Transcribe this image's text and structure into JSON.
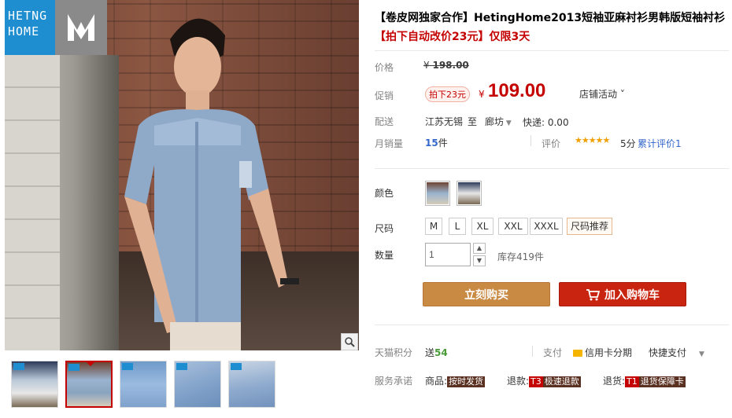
{
  "brand": {
    "logo_text_line1": "HETNG",
    "logo_text_line2": "HOME"
  },
  "product": {
    "title": "【卷皮网独家合作】HetingHome2013短袖亚麻衬衫男韩版短袖衬衫",
    "promo": "【拍下自动改价23元】仅限3天"
  },
  "price": {
    "label": "价格",
    "currency": "¥",
    "original": "198.00"
  },
  "promotion": {
    "label": "促销",
    "badge": "拍下23元",
    "currency": "¥",
    "value": "109.00",
    "activity": "店铺活动"
  },
  "shipping": {
    "label": "配送",
    "from": "江苏无锡",
    "to_word": "至",
    "destination": "廊坊",
    "fee": "快递: 0.00"
  },
  "sales": {
    "label": "月销量",
    "count": "15",
    "unit": "件",
    "review_label": "评价",
    "stars": "★★★★★",
    "score": "5分",
    "review_link": "累计评价1"
  },
  "color": {
    "label": "颜色"
  },
  "size": {
    "label": "尺码",
    "options": [
      "M",
      "L",
      "XL",
      "XXL",
      "XXXL"
    ],
    "recommend": "尺码推荐"
  },
  "quantity": {
    "label": "数量",
    "value": "1",
    "stock": "库存419件"
  },
  "buttons": {
    "buy": "立刻购买",
    "cart": "加入购物车"
  },
  "points": {
    "label": "天猫积分",
    "prefix": "送",
    "value": "54",
    "pay_label": "支付",
    "credit": "信用卡分期",
    "quick": "快捷支付"
  },
  "service": {
    "label": "服务承诺",
    "goods_prefix": "商品:",
    "goods_tag": "按时发货",
    "refund_prefix": "退款:",
    "refund_code": "T3",
    "refund_tag": "极速退款",
    "return_prefix": "退货:",
    "return_code": "T1",
    "return_tag": "退货保障卡"
  },
  "colors": {
    "accent": "#c40000",
    "buy": "#c98a44",
    "cart": "#c9240f",
    "logo_blue": "#1f8ed0"
  }
}
